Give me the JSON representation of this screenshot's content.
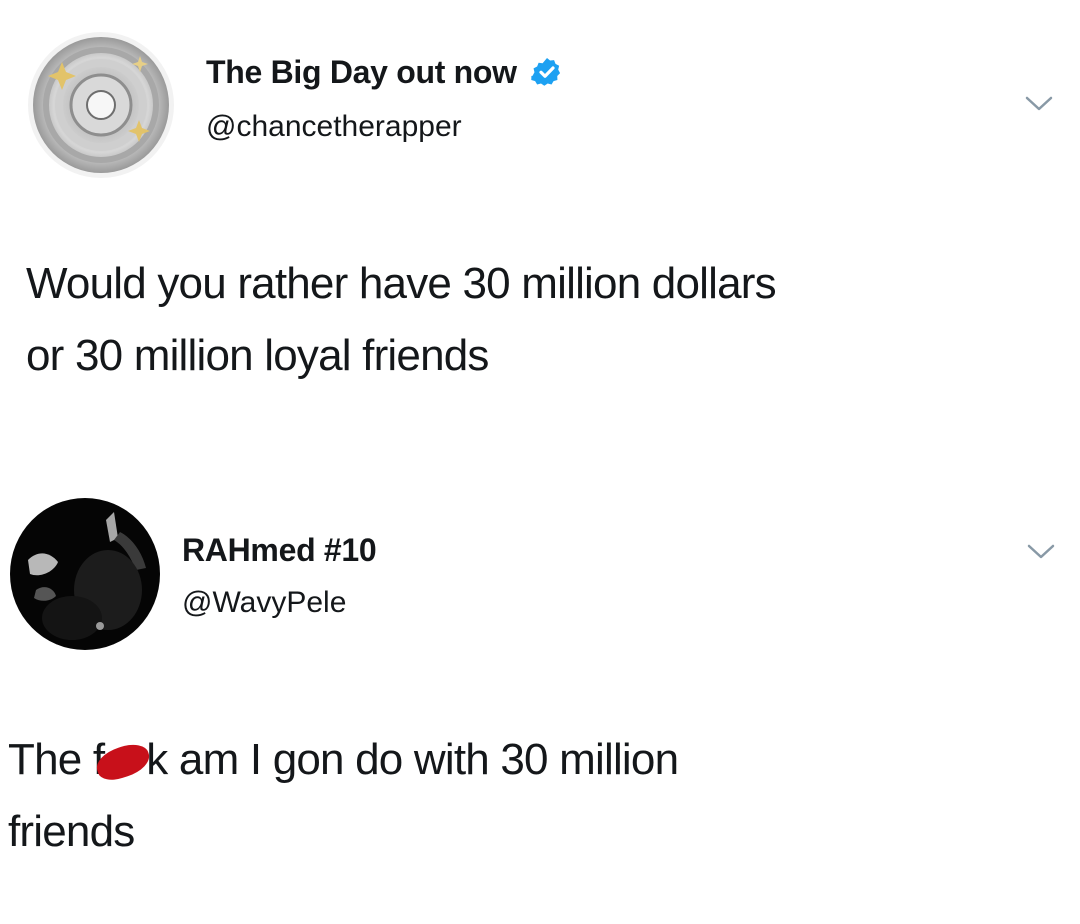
{
  "tweets": [
    {
      "display_name": "The Big Day out now",
      "verified": true,
      "handle": "@chancetherapper",
      "text_lines": [
        "Would you rather have 30 million dollars",
        "or 30 million loyal friends"
      ],
      "avatar": "spinning-disc-avatar"
    },
    {
      "display_name": "RAHmed #10",
      "verified": false,
      "handle": "@WavyPele",
      "text_before_censor": "The f",
      "text_after_censor": "k am I gon do with 30 million",
      "text_line_2": "friends",
      "censor_color": "#c8101a",
      "avatar": "dark-photo-avatar"
    }
  ],
  "icons": {
    "verified": "verified-badge-icon",
    "menu": "chevron-down-icon"
  },
  "colors": {
    "verified_blue": "#1da1f2",
    "text": "#14171a",
    "caret": "#8899a6"
  }
}
